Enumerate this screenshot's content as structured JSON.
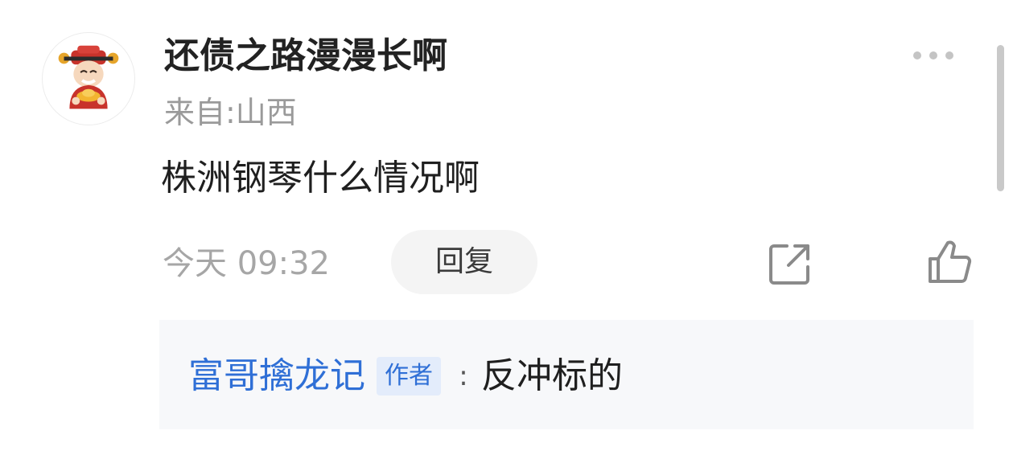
{
  "comment": {
    "username": "还债之路漫漫长啊",
    "location": "来自:山西",
    "text": "株洲钢琴什么情况啊",
    "timestamp": "今天 09:32",
    "reply_label": "回复",
    "icons": {
      "more": "more-dots-icon",
      "share": "share-icon",
      "like": "thumbs-up-icon"
    }
  },
  "reply": {
    "author": "富哥擒龙记",
    "badge": "作者",
    "separator": ":",
    "content": "反冲标的"
  },
  "colors": {
    "link_blue": "#2f6fd6",
    "badge_bg": "#e3ecfb",
    "reply_bg": "#f7f8fa",
    "muted_gray": "#9a9a9a"
  }
}
